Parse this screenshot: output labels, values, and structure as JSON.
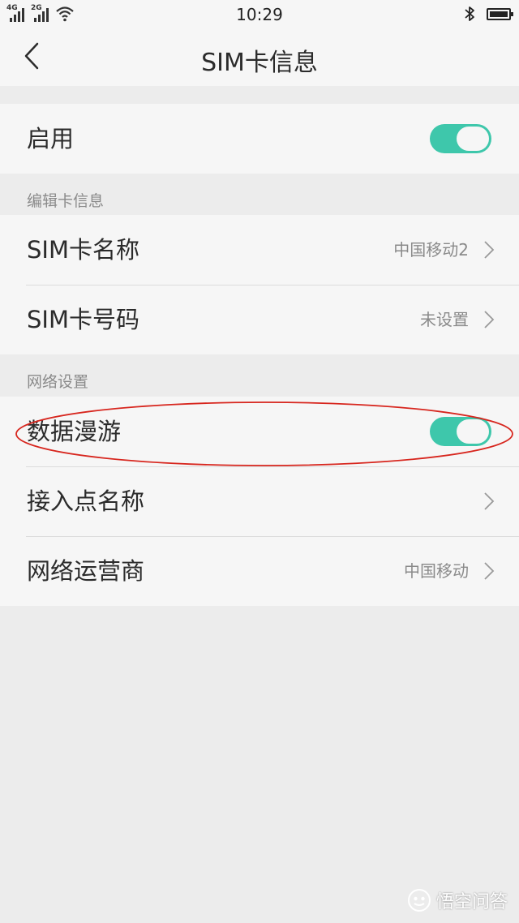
{
  "status_bar": {
    "time": "10:29",
    "sim1_network": "4G",
    "sim2_network": "2G",
    "icons": [
      "signal-icon",
      "wifi-icon",
      "bluetooth-icon",
      "battery-icon"
    ]
  },
  "nav": {
    "title": "SIM卡信息",
    "back_icon": "chevron-left-icon"
  },
  "enable_row": {
    "label": "启用",
    "enabled": true
  },
  "edit_section": {
    "header": "编辑卡信息",
    "items": [
      {
        "label": "SIM卡名称",
        "value": "中国移动2"
      },
      {
        "label": "SIM卡号码",
        "value": "未设置"
      }
    ]
  },
  "network_section": {
    "header": "网络设置",
    "items": [
      {
        "label": "数据漫游",
        "toggle": true,
        "enabled": true
      },
      {
        "label": "接入点名称",
        "value": ""
      },
      {
        "label": "网络运营商",
        "value": "中国移动"
      }
    ]
  },
  "watermark": {
    "text": "悟空问答"
  },
  "colors": {
    "toggle_on": "#3ec7ab",
    "annotation_ellipse": "#d7261e",
    "background": "#ececec",
    "card": "#f6f6f6"
  }
}
